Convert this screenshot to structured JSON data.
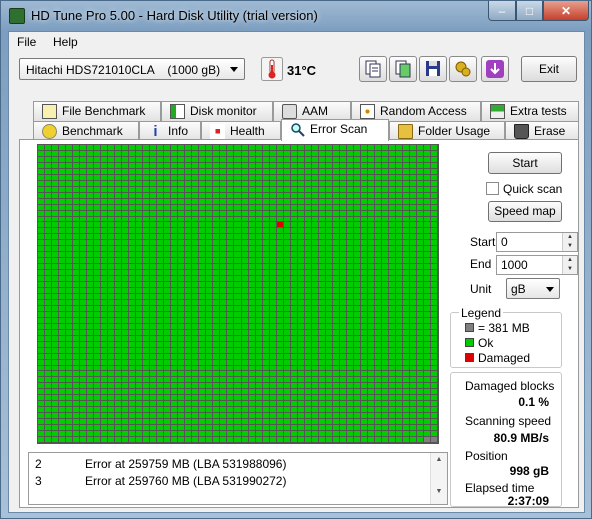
{
  "window": {
    "title": "HD Tune Pro 5.00 - Hard Disk Utility (trial version)",
    "minimize": "–",
    "maximize": "□",
    "close": "✕"
  },
  "menu": [
    "File",
    "Help"
  ],
  "toolbar": {
    "drive": "Hitachi HDS721010CLA    (1000 gB)",
    "temperature": "31°C",
    "exit": "Exit",
    "buttons": [
      "copy-text-icon",
      "copy-screenshot-icon",
      "save-icon",
      "options-icon",
      "download-icon"
    ]
  },
  "tabs_top": [
    "File Benchmark",
    "Disk monitor",
    "AAM",
    "Random Access",
    "Extra tests"
  ],
  "tabs_bottom": [
    "Benchmark",
    "Info",
    "Health",
    "Error Scan",
    "Folder Usage",
    "Erase"
  ],
  "active_tab": "Error Scan",
  "scan": {
    "start_button": "Start",
    "quick_scan_label": "Quick scan",
    "quick_scan_checked": false,
    "speed_map_button": "Speed map",
    "start_label": "Start",
    "start_value": "0",
    "end_label": "End",
    "end_value": "1000",
    "unit_label": "Unit",
    "unit_value": "gB"
  },
  "legend": {
    "title": "Legend",
    "block": "= 381 MB",
    "ok": "Ok",
    "damaged": "Damaged",
    "colors": {
      "ok": "#00cc00",
      "damaged": "#dd0000",
      "unscanned": "#808080"
    }
  },
  "stats": {
    "damaged_label": "Damaged blocks",
    "damaged_value": "0.1 %",
    "speed_label": "Scanning speed",
    "speed_value": "80.9 MB/s",
    "position_label": "Position",
    "position_value": "998 gB",
    "elapsed_label": "Elapsed time",
    "elapsed_value": "2:37:09"
  },
  "log": [
    {
      "n": "2",
      "text": "Error at 259759 MB (LBA 531988096)"
    },
    {
      "n": "3",
      "text": "Error at 259760 MB (LBA 531990272)"
    }
  ],
  "grid": {
    "cols": 57,
    "rows": 50,
    "damaged": [
      [
        34,
        13
      ]
    ],
    "unscanned": [
      [
        55,
        49
      ],
      [
        56,
        49
      ]
    ]
  }
}
